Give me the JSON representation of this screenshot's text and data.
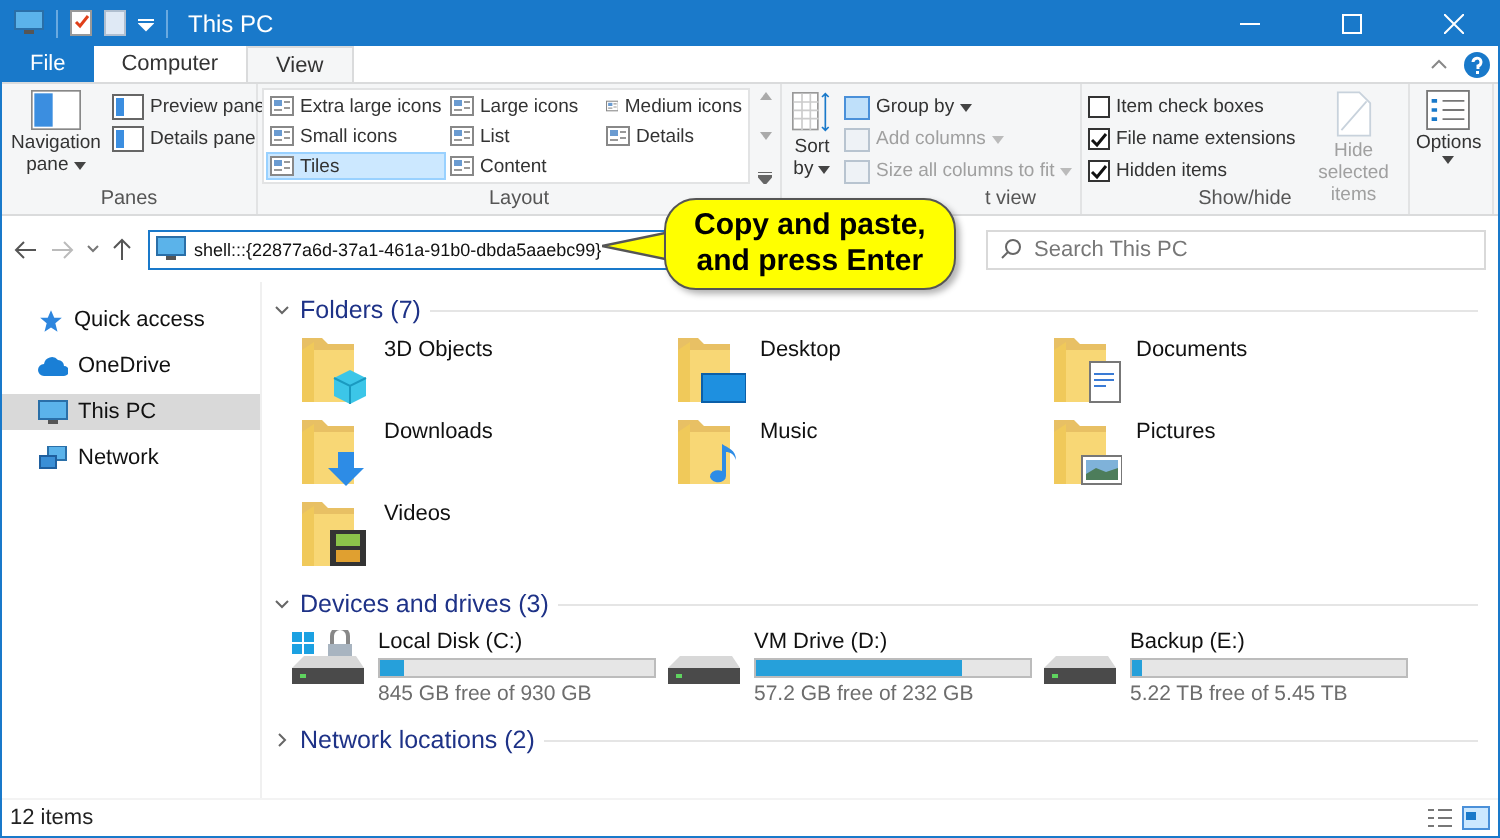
{
  "window": {
    "title": "This PC"
  },
  "tabs": [
    {
      "label": "File",
      "kind": "file",
      "selected": false
    },
    {
      "label": "Computer",
      "kind": "tab",
      "selected": false
    },
    {
      "label": "View",
      "kind": "tab",
      "selected": true
    }
  ],
  "ribbon": {
    "panes": {
      "label": "Panes",
      "large": "Navigation pane",
      "items": [
        "Preview pane",
        "Details pane"
      ]
    },
    "layout": {
      "label": "Layout",
      "items": [
        {
          "label": "Extra large icons",
          "selected": false
        },
        {
          "label": "Large icons",
          "selected": false
        },
        {
          "label": "Medium icons",
          "selected": false
        },
        {
          "label": "Small icons",
          "selected": false
        },
        {
          "label": "List",
          "selected": false
        },
        {
          "label": "Details",
          "selected": false
        },
        {
          "label": "Tiles",
          "selected": true
        },
        {
          "label": "Content",
          "selected": false
        }
      ]
    },
    "current_view": {
      "label": "t view",
      "sort": "Sort by",
      "items": [
        {
          "label": "Group by",
          "disabled": false
        },
        {
          "label": "Add columns",
          "disabled": true
        },
        {
          "label": "Size all columns to fit",
          "disabled": true
        }
      ]
    },
    "show_hide": {
      "label": "Show/hide",
      "checks": [
        {
          "label": "Item check boxes",
          "checked": false
        },
        {
          "label": "File name extensions",
          "checked": true
        },
        {
          "label": "Hidden items",
          "checked": true
        }
      ],
      "hide": {
        "label": "Hide selected items",
        "disabled": true
      }
    },
    "options": {
      "label": "Options"
    }
  },
  "address": {
    "value": "shell:::{22877a6d-37a1-461a-91b0-dbda5aaebc99}"
  },
  "search": {
    "placeholder": "Search This PC"
  },
  "callout": {
    "lines": [
      "Copy and paste,",
      "and press Enter"
    ]
  },
  "sidebar": {
    "items": [
      {
        "label": "Quick access",
        "kind": "star",
        "selected": false
      },
      {
        "label": "OneDrive",
        "kind": "cloud",
        "selected": false
      },
      {
        "label": "This PC",
        "kind": "pc",
        "selected": true
      },
      {
        "label": "Network",
        "kind": "network",
        "selected": false
      }
    ]
  },
  "folders": {
    "header": "Folders (7)",
    "expanded": true,
    "items": [
      {
        "name": "3D Objects",
        "kind": "cube"
      },
      {
        "name": "Desktop",
        "kind": "desktop"
      },
      {
        "name": "Documents",
        "kind": "document"
      },
      {
        "name": "Downloads",
        "kind": "download"
      },
      {
        "name": "Music",
        "kind": "music"
      },
      {
        "name": "Pictures",
        "kind": "picture"
      },
      {
        "name": "Videos",
        "kind": "video"
      }
    ]
  },
  "drives": {
    "header": "Devices and drives (3)",
    "expanded": true,
    "items": [
      {
        "name": "Local Disk (C:)",
        "kind": "system",
        "level": 0.09,
        "free": "845 GB free of 930 GB"
      },
      {
        "name": "VM Drive (D:)",
        "kind": "drive",
        "level": 0.75,
        "free": "57.2 GB free of 232 GB"
      },
      {
        "name": "Backup (E:)",
        "kind": "drive",
        "level": 0.04,
        "free": "5.22 TB free of 5.45 TB"
      }
    ]
  },
  "network": {
    "header": "Network locations (2)",
    "expanded": false
  },
  "status_bar": {
    "count": "12 items"
  }
}
